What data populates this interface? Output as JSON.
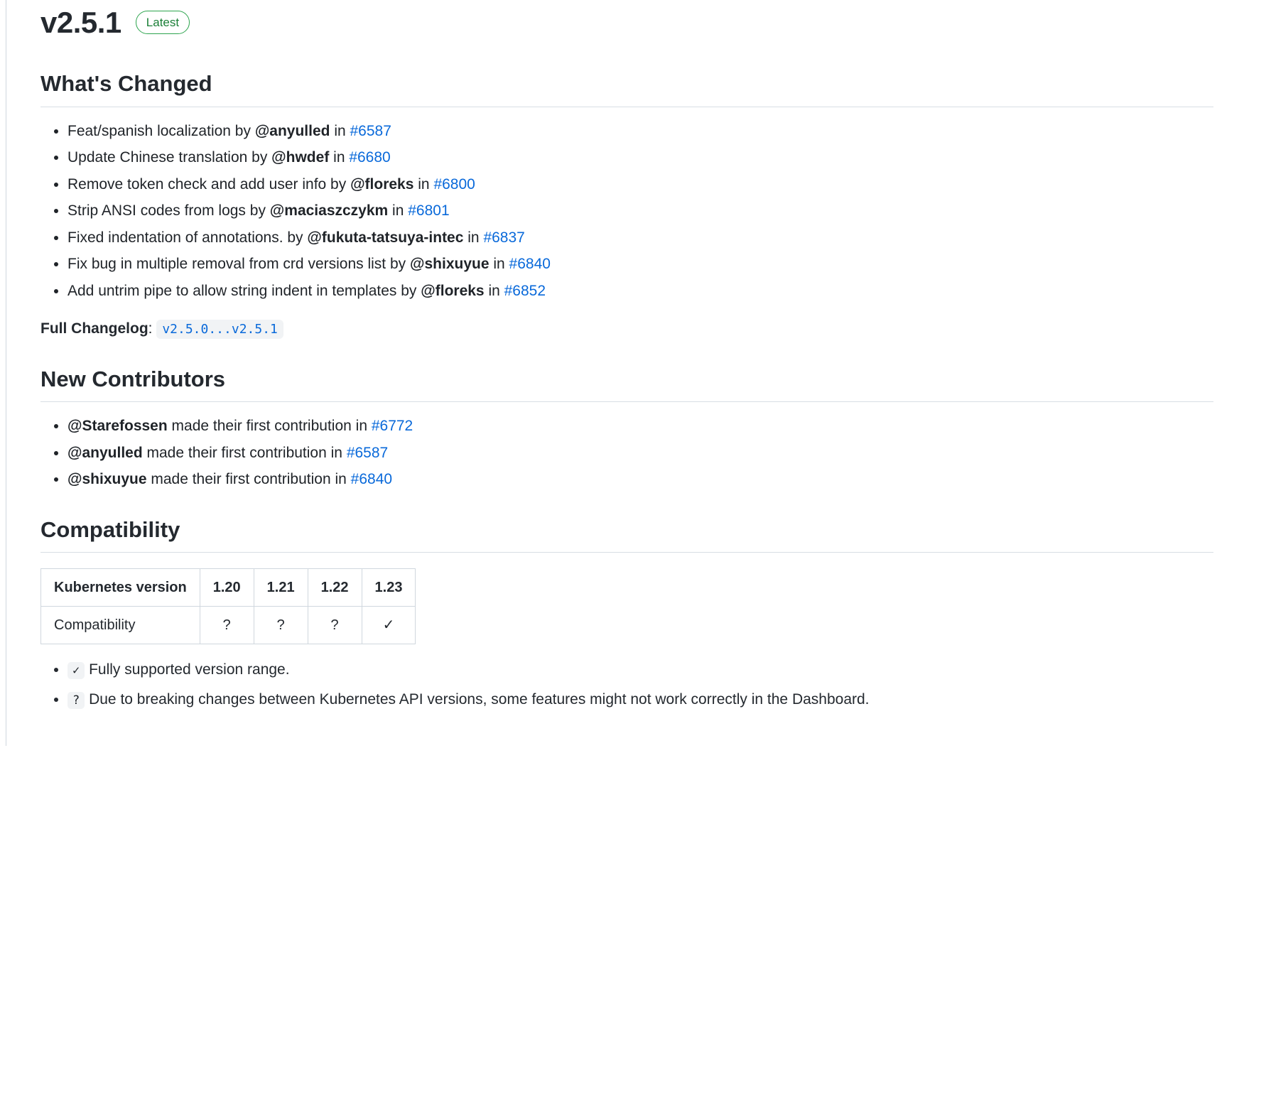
{
  "title": {
    "version": "v2.5.1",
    "badge": "Latest"
  },
  "sections": {
    "whats_changed": "What's Changed",
    "new_contributors": "New Contributors",
    "compatibility": "Compatibility"
  },
  "changes": [
    {
      "text": "Feat/spanish localization by ",
      "author": "@anyulled",
      "in": " in ",
      "pr": "#6587"
    },
    {
      "text": "Update Chinese translation by ",
      "author": "@hwdef",
      "in": " in ",
      "pr": "#6680"
    },
    {
      "text": "Remove token check and add user info by ",
      "author": "@floreks",
      "in": " in ",
      "pr": "#6800"
    },
    {
      "text": "Strip ANSI codes from logs by ",
      "author": "@maciaszczykm",
      "in": " in ",
      "pr": "#6801"
    },
    {
      "text": "Fixed indentation of annotations. by ",
      "author": "@fukuta-tatsuya-intec",
      "in": " in ",
      "pr": "#6837"
    },
    {
      "text": "Fix bug in multiple removal from crd versions list by ",
      "author": "@shixuyue",
      "in": " in ",
      "pr": "#6840"
    },
    {
      "text": "Add untrim pipe to allow string indent in templates by ",
      "author": "@floreks",
      "in": " in ",
      "pr": "#6852"
    }
  ],
  "full_changelog": {
    "label": "Full Changelog",
    "colon": ": ",
    "range": "v2.5.0...v2.5.1"
  },
  "new_contributors": [
    {
      "author": "@Starefossen",
      "mid": " made their first contribution in ",
      "pr": "#6772"
    },
    {
      "author": "@anyulled",
      "mid": " made their first contribution in ",
      "pr": "#6587"
    },
    {
      "author": "@shixuyue",
      "mid": " made their first contribution in ",
      "pr": "#6840"
    }
  ],
  "compat_table": {
    "headers": [
      "Kubernetes version",
      "1.20",
      "1.21",
      "1.22",
      "1.23"
    ],
    "row_label": "Compatibility",
    "cells": [
      "?",
      "?",
      "?",
      "✓"
    ]
  },
  "legend": [
    {
      "sym": "✓",
      "text": " Fully supported version range."
    },
    {
      "sym": "?",
      "text": " Due to breaking changes between Kubernetes API versions, some features might not work correctly in the Dashboard."
    }
  ]
}
